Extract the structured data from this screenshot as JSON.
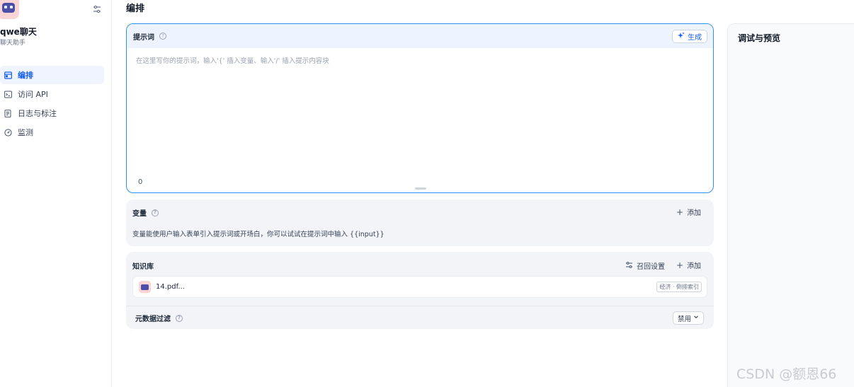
{
  "sidebar": {
    "app_name": "qwe聊天",
    "app_desc": "聊天助手",
    "items": [
      {
        "label": "编排",
        "active": true,
        "icon": "layout-icon"
      },
      {
        "label": "访问 API",
        "active": false,
        "icon": "terminal-icon"
      },
      {
        "label": "日志与标注",
        "active": false,
        "icon": "log-icon"
      },
      {
        "label": "监测",
        "active": false,
        "icon": "gauge-icon"
      }
    ]
  },
  "main": {
    "title": "编排",
    "prompt": {
      "label": "提示词",
      "generate_label": "生成",
      "placeholder": "在这里写你的提示词，输入'{' 插入变量、输入'/' 插入提示内容块",
      "value": "",
      "char_count": "0"
    },
    "variables": {
      "label": "变量",
      "add_label": "添加",
      "description": "变量能使用户输入表单引入提示词或开场白，你可以试试在提示词中输入 {{input}}"
    },
    "knowledge": {
      "label": "知识库",
      "recall_label": "召回设置",
      "add_label": "添加",
      "items": [
        {
          "name": "14.pdf...",
          "tag": "经济 · 倒排索引"
        }
      ],
      "metadata_filter": {
        "label": "元数据过滤",
        "value": "禁用"
      }
    }
  },
  "preview": {
    "title": "调试与预览"
  },
  "watermark": "CSDN @额恩66",
  "colors": {
    "accent": "#155eef",
    "prompt_border": "#2e90fa",
    "card_bg": "#f2f4f7",
    "active_nav_bg": "#eff4ff"
  }
}
